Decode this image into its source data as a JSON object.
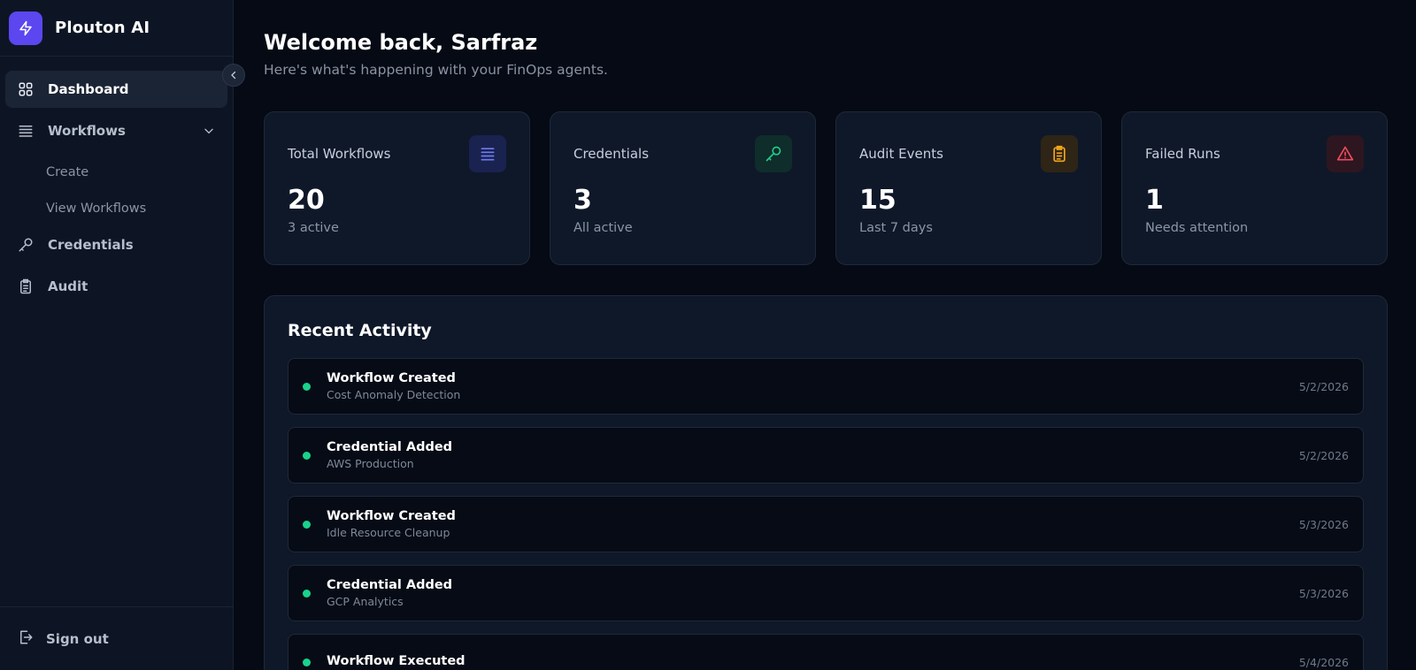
{
  "brand": {
    "name": "Plouton AI",
    "icon": "bolt-icon",
    "color": "#5b46f0"
  },
  "sidebar": {
    "collapse_icon": "chevron-left-icon",
    "items": [
      {
        "label": "Dashboard",
        "icon": "grid-icon",
        "active": true
      },
      {
        "label": "Workflows",
        "icon": "list-icon",
        "expanded": true,
        "children": [
          {
            "label": "Create"
          },
          {
            "label": "View Workflows"
          }
        ]
      },
      {
        "label": "Credentials",
        "icon": "key-icon"
      },
      {
        "label": "Audit",
        "icon": "clipboard-icon"
      }
    ],
    "signout": {
      "label": "Sign out",
      "icon": "logout-icon"
    }
  },
  "header": {
    "title": "Welcome back, Sarfraz",
    "subtitle": "Here's what's happening with your FinOps agents."
  },
  "stats": [
    {
      "label": "Total Workflows",
      "value": "20",
      "sub": "3 active",
      "icon": "list-icon",
      "color": "#6e7bf2"
    },
    {
      "label": "Credentials",
      "value": "3",
      "sub": "All active",
      "icon": "key-icon",
      "color": "#22c98a"
    },
    {
      "label": "Audit Events",
      "value": "15",
      "sub": "Last 7 days",
      "icon": "clipboard-icon",
      "color": "#f0a41c"
    },
    {
      "label": "Failed Runs",
      "value": "1",
      "sub": "Needs attention",
      "icon": "alert-triangle-icon",
      "color": "#ef4b5a"
    }
  ],
  "activity": {
    "title": "Recent Activity",
    "items": [
      {
        "title": "Workflow Created",
        "desc": "Cost Anomaly Detection",
        "date": "5/2/2026"
      },
      {
        "title": "Credential Added",
        "desc": "AWS Production",
        "date": "5/2/2026"
      },
      {
        "title": "Workflow Created",
        "desc": "Idle Resource Cleanup",
        "date": "5/3/2026"
      },
      {
        "title": "Credential Added",
        "desc": "GCP Analytics",
        "date": "5/3/2026"
      },
      {
        "title": "Workflow Executed",
        "desc": "",
        "date": "5/4/2026"
      }
    ]
  },
  "colors": {
    "status_dot": "#19d38b",
    "background": "#050a14",
    "surface": "#0f1829"
  }
}
